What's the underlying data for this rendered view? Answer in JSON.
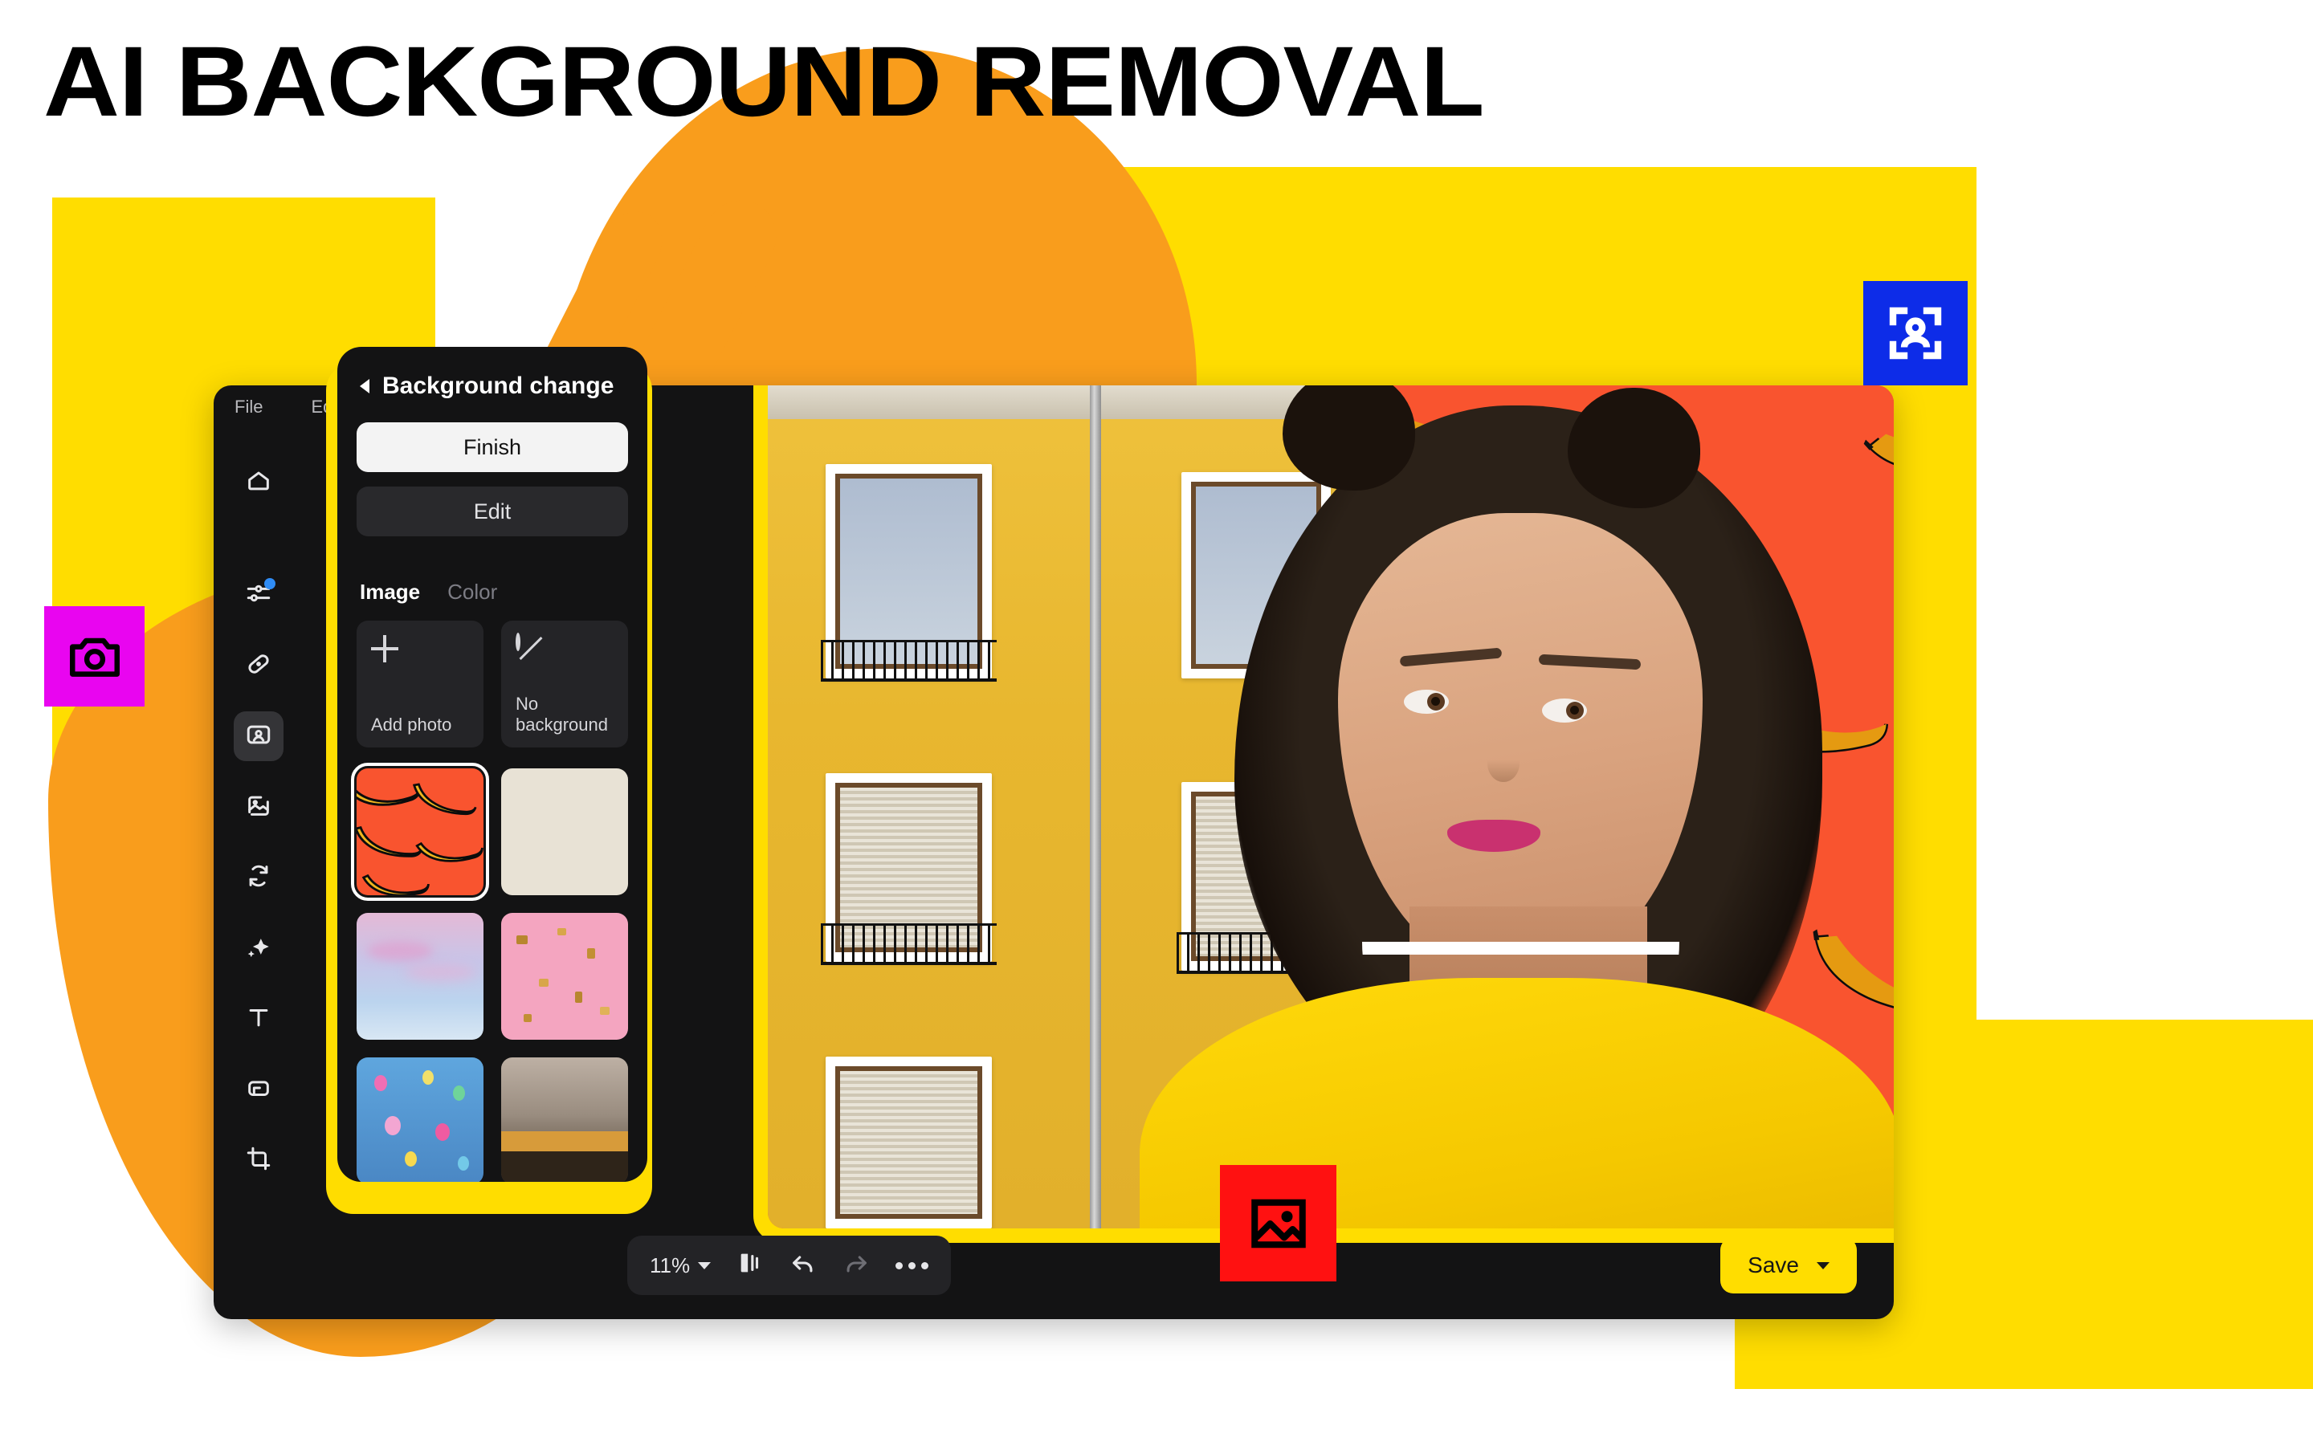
{
  "headline": "AI BACKGROUND REMOVAL",
  "colors": {
    "brand_yellow": "#FFDD00",
    "orange": "#F99D1C",
    "coral": "#F9542F",
    "magenta": "#E905F0",
    "blue": "#0D2CE8",
    "red": "#FF1111",
    "panel_dark": "#131314"
  },
  "badges": [
    {
      "name": "camera-badge",
      "icon": "camera-icon",
      "color": "#E905F0"
    },
    {
      "name": "face-scan-badge",
      "icon": "face-scan-icon",
      "color": "#0D2CE8"
    },
    {
      "name": "image-badge",
      "icon": "image-icon",
      "color": "#FF1111"
    }
  ],
  "app": {
    "menubar": {
      "items": [
        "File",
        "Edit"
      ]
    },
    "toolbar_rail": [
      {
        "label": "Home",
        "icon": "home-icon",
        "active": false,
        "badge": false
      },
      {
        "label": "Adjustments",
        "icon": "sliders-icon",
        "active": false,
        "badge": true
      },
      {
        "label": "Retouch",
        "icon": "bandage-icon",
        "active": false,
        "badge": false
      },
      {
        "label": "Portrait",
        "icon": "portrait-icon",
        "active": true,
        "badge": false
      },
      {
        "label": "Background",
        "icon": "image-edit-icon",
        "active": false,
        "badge": false
      },
      {
        "label": "Replace",
        "icon": "refresh-icon",
        "active": false,
        "badge": false
      },
      {
        "label": "Effects",
        "icon": "sparkle-icon",
        "active": false,
        "badge": false
      },
      {
        "label": "Text",
        "icon": "text-icon",
        "active": false,
        "badge": false
      },
      {
        "label": "Frame",
        "icon": "frame-icon",
        "active": false,
        "badge": false
      },
      {
        "label": "Crop",
        "icon": "crop-icon",
        "active": false,
        "badge": false
      }
    ],
    "bottom_toolbar": {
      "zoom_level": "11%",
      "zoom_chevron_icon": "chevron-down-icon",
      "compare_icon": "compare-icon",
      "undo_icon": "undo-icon",
      "redo_icon": "redo-icon",
      "more_icon": "more-dots-icon"
    },
    "save": {
      "label": "Save",
      "chevron_icon": "chevron-down-icon"
    }
  },
  "panel": {
    "back_icon": "chevron-left-icon",
    "title": "Background change",
    "finish_label": "Finish",
    "edit_label": "Edit",
    "tabs": [
      {
        "label": "Image",
        "active": true
      },
      {
        "label": "Color",
        "active": false
      }
    ],
    "actions": [
      {
        "label": "Add photo",
        "icon": "plus-icon"
      },
      {
        "label": "No background",
        "icon": "no-symbol-icon"
      }
    ],
    "thumbnails": [
      {
        "name": "banana-pattern",
        "selected": true
      },
      {
        "name": "paper-texture",
        "selected": false
      },
      {
        "name": "pastel-sky",
        "selected": false
      },
      {
        "name": "pink-confetti",
        "selected": false
      },
      {
        "name": "blue-balloons",
        "selected": false
      },
      {
        "name": "building-facade",
        "selected": false
      }
    ]
  },
  "canvas": {
    "background_name": "banana-pattern",
    "subject_name": "woman-portrait"
  }
}
